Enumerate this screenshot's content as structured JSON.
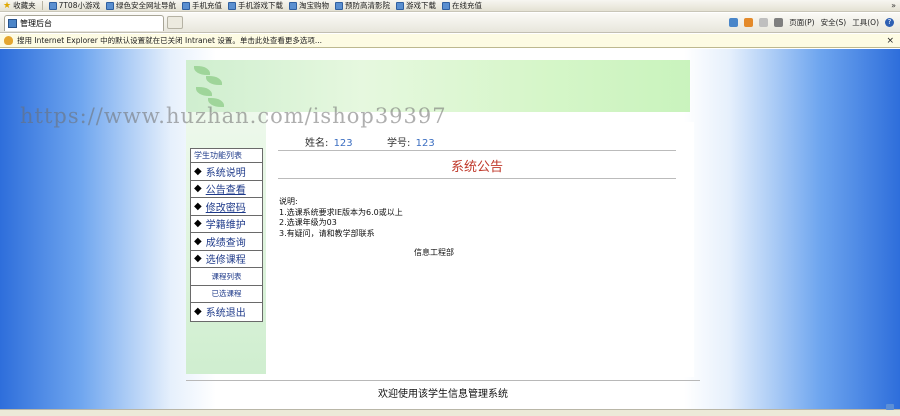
{
  "browser": {
    "favorites_label": "收藏夹",
    "favorites": [
      {
        "label": "7T08小游戏"
      },
      {
        "label": "绿色安全网址导航"
      },
      {
        "label": "手机充值"
      },
      {
        "label": "手机游戏下载"
      },
      {
        "label": "淘宝购物"
      },
      {
        "label": "预防高清影院"
      },
      {
        "label": "游戏下载"
      },
      {
        "label": "在线充值"
      }
    ],
    "more_chevron": "»",
    "tab_title": "管理后台",
    "commands": {
      "page": "页面(P)",
      "safety": "安全(S)",
      "tools": "工具(O)",
      "help": "?"
    },
    "info_bar_text": "搜用 Internet Explorer 中的默认设置就在已关闭 Intranet 设置。单击此处查看更多选项...",
    "info_close": "×"
  },
  "page": {
    "watermark": "https://www.huzhan.com/ishop39397",
    "menu": {
      "header": "学生功能列表",
      "items": [
        {
          "label": "系统说明"
        },
        {
          "label": "公告查看"
        },
        {
          "label": "修改密码"
        },
        {
          "label": "学籍维护"
        },
        {
          "label": "成绩查询"
        },
        {
          "label": "选修课程"
        }
      ],
      "sub_items": [
        {
          "label": "课程列表"
        },
        {
          "label": "已选课程"
        }
      ],
      "exit": {
        "label": "系统退出"
      },
      "bullet": "◆"
    },
    "user": {
      "name_label": "姓名:",
      "name_value": "123",
      "id_label": "学号:",
      "id_value": "123"
    },
    "title": "系统公告",
    "notice": {
      "heading": "说明:",
      "lines": [
        "1.选课系统要求IE版本为6.0或以上",
        "2.选课年级为03",
        "3.有疑问，请和教学部联系"
      ]
    },
    "signature": "信息工程部",
    "footer": "欢迎使用该学生信息管理系统"
  },
  "colors": {
    "menu_text": "#1e3a8a",
    "title": "#c0392b",
    "user_value": "#3b6ec1",
    "gradient_blue": "#2e6edb"
  }
}
